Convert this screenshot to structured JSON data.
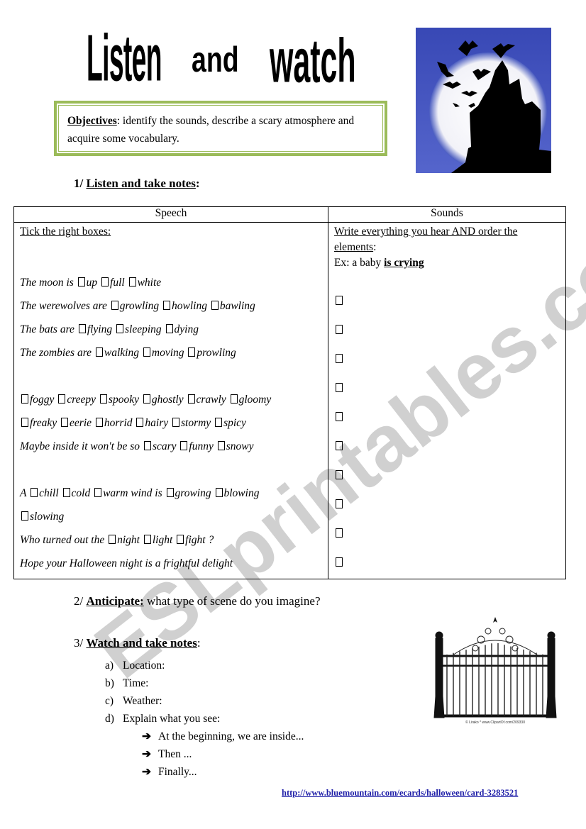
{
  "title": {
    "word1": "Listen",
    "word2": "and",
    "word3": "watch"
  },
  "objectives": {
    "label": "Objectives",
    "text": ": identify the sounds, describe a scary atmosphere and acquire some vocabulary."
  },
  "section1": {
    "number": "1/",
    "title": "Listen and take notes",
    "suffix": ":"
  },
  "table": {
    "headers": [
      "Speech",
      "Sounds"
    ],
    "speech": {
      "instruction": "Tick the right boxes:",
      "lines": [
        {
          "parts": [
            "The moon is ",
            "up",
            "full",
            "white"
          ]
        },
        {
          "parts": [
            "The werewolves are ",
            "growling",
            "howling",
            "bawling"
          ]
        },
        {
          "parts": [
            "The bats are ",
            "flying",
            "sleeping",
            "dying"
          ]
        },
        {
          "parts": [
            "The zombies are ",
            "walking",
            "moving",
            "prowling"
          ]
        },
        {
          "parts": [
            "",
            "foggy",
            "creepy",
            "spooky",
            "ghostly",
            "crawly",
            "gloomy"
          ]
        },
        {
          "parts": [
            "",
            "freaky",
            "eerie",
            "horrid",
            "hairy",
            "stormy",
            "spicy"
          ]
        },
        {
          "parts": [
            "Maybe inside it won't be so ",
            "scary",
            "funny",
            "snowy"
          ]
        },
        {
          "parts": [
            "A ",
            "chill",
            "cold",
            "warm wind is",
            "growing",
            "blowing"
          ]
        },
        {
          "parts": [
            "",
            "slowing"
          ]
        },
        {
          "parts": [
            "Who turned out the ",
            "night",
            "light",
            "fight ?"
          ]
        },
        {
          "text": "Hope your Halloween night is a frightful delight"
        }
      ]
    },
    "sounds": {
      "instruction_line1": "Write everything you hear AND order the",
      "instruction_line2": "elements",
      "instruction_suffix": ":",
      "example_prefix": "Ex: a baby ",
      "example_strong": "is crying",
      "box_count": 10
    }
  },
  "section2": {
    "number": "2/",
    "title": "Anticipate:",
    "text": " what type of scene do you imagine?"
  },
  "section3": {
    "number": "3/",
    "title": "Watch and take notes",
    "suffix": ":",
    "items": [
      {
        "marker": "a)",
        "text": "Location:"
      },
      {
        "marker": "b)",
        "text": "Time:"
      },
      {
        "marker": "c)",
        "text": "Weather:"
      },
      {
        "marker": "d)",
        "text": "Explain what you see:"
      }
    ],
    "subitems": [
      "At the beginning, we are inside...",
      "Then ...",
      "Finally..."
    ]
  },
  "images": {
    "halloween": "haunted-house-moon-bats",
    "gate": "wrought-iron-gate",
    "gate_caption": "© Lirako  *  www.ClipartOf.com/209330"
  },
  "link": "http://www.bluemountain.com/ecards/halloween/card-3283521",
  "watermark": "ESLprintables.com",
  "colors": {
    "frame_green": "#9bbb59",
    "sky_blue": "#4a5cc0",
    "link_blue": "#1f1fa8"
  }
}
